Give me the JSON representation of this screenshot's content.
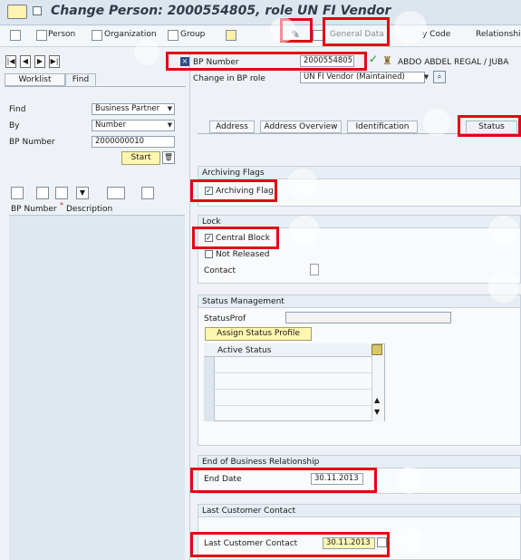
{
  "window": {
    "title": "Change Person: 2000554805, role UN FI Vendor"
  },
  "toolbar": {
    "person": "Person",
    "organization": "Organization",
    "group": "Group",
    "general_data": "General Data",
    "company_code": "y Code",
    "relationships": "Relationship"
  },
  "left_tabs": {
    "worklist": "Worklist",
    "find": "Find"
  },
  "search": {
    "find_label": "Find",
    "find_value": "Business Partner",
    "by_label": "By",
    "by_value": "Number",
    "bp_number_label": "BP Number",
    "bp_number_value": "2000000010",
    "start_button": "Start"
  },
  "left_grid": {
    "columns": [
      "BP Number",
      "Description"
    ]
  },
  "header": {
    "bp_number_label": "BP Number",
    "bp_number_value": "2000554805",
    "partner_name": "ABDO ABDEL REGAL / JUBA",
    "change_role_label": "Change in BP role",
    "change_role_value": "UN FI Vendor (Maintained)"
  },
  "tabs": {
    "address": "Address",
    "address_overview": "Address Overview",
    "identification": "Identification",
    "status": "Status"
  },
  "archiving": {
    "title": "Archiving Flags",
    "flag_label": "Archiving Flag"
  },
  "lock": {
    "title": "Lock",
    "central_block": "Central Block",
    "not_released": "Not Released",
    "contact_label": "Contact"
  },
  "status_management": {
    "title": "Status Management",
    "status_prof_label": "StatusProf",
    "assign_button": "Assign Status Profile",
    "active_status_header": "Active Status"
  },
  "end_business": {
    "title": "End of Business Relationship",
    "end_date_label": "End Date",
    "end_date_value": "30.11.2013"
  },
  "last_customer_contact": {
    "title": "Last Customer Contact",
    "label": "Last Customer Contact",
    "value": "30.11.2013"
  }
}
